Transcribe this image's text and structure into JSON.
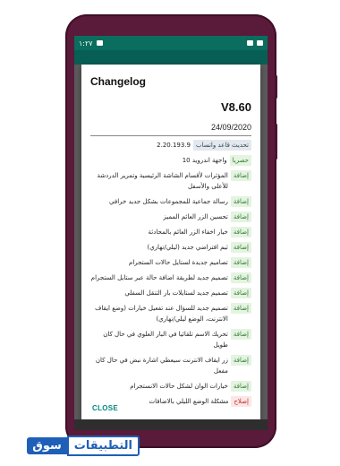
{
  "statusbar": {
    "left": "١:٢٧",
    "right": ""
  },
  "dialog": {
    "title": "Changelog",
    "version": "V8.60",
    "date": "24/09/2020",
    "close_label": "CLOSE"
  },
  "changes": [
    {
      "tag": "تحديث قاعد واتساب",
      "kind": "update",
      "text": "2.20.193.9"
    },
    {
      "tag": "حصريا",
      "kind": "excl",
      "text": "واجهة اندرويد 10"
    },
    {
      "tag": "إضافة",
      "kind": "add",
      "text": "المؤثرات لأقسام الشاشة الرئيسية وتمرير الدردشة للأعلى والأسفل"
    },
    {
      "tag": "إضافة",
      "kind": "add",
      "text": "رسالة جماعية للمجموعات بشكل جديد خرافي"
    },
    {
      "tag": "إضافة",
      "kind": "add",
      "text": "تحسين الزر العائم المميز"
    },
    {
      "tag": "إضافة",
      "kind": "add",
      "text": "خيار اخفاء الزر العائم بالمحادثة"
    },
    {
      "tag": "إضافة",
      "kind": "add",
      "text": "ثيم افتراضي جديد (ليلي/نهاري)"
    },
    {
      "tag": "إضافة",
      "kind": "add",
      "text": "تصاميم جديدة لستايل حالات الستجرام"
    },
    {
      "tag": "إضافة",
      "kind": "add",
      "text": "تصميم جديد لطريقة اضافة حالة عبر ستايل الستجرام"
    },
    {
      "tag": "إضافة",
      "kind": "add",
      "text": "تصميم جديد لستايلات بار التنقل السفلي"
    },
    {
      "tag": "إضافة",
      "kind": "add",
      "text": "تصميم جديد للسؤال عند تفعيل خيارات (وضع ايقاف الانترنت، الوضع ليلي/نهاري)"
    },
    {
      "tag": "إضافة",
      "kind": "add",
      "text": "تحريك الاسم تلقائيا في البار العلوي في حال كان طويل"
    },
    {
      "tag": "إضافة",
      "kind": "add",
      "text": "زر ايقاف الانترنت سيعطي اشارة نبض في حال كان مفعل"
    },
    {
      "tag": "إضافة",
      "kind": "add",
      "text": "خيارات الوان لشكل حالات الانستجرام"
    },
    {
      "tag": "إصلاح",
      "kind": "fix",
      "text": "مشكلة الوضع الليلي بالاضافات"
    }
  ],
  "watermark": {
    "part_a": "سوق",
    "part_b": "التطبيقات"
  }
}
